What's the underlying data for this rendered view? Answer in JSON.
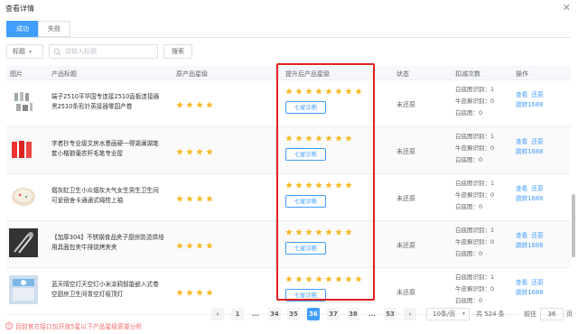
{
  "dialog": {
    "title": "查看详情"
  },
  "tabs": [
    {
      "label": "成功"
    },
    {
      "label": "失败"
    }
  ],
  "search": {
    "select_value": "标题",
    "placeholder": "请输入标题",
    "button": "搜索"
  },
  "table": {
    "headers": [
      "图片",
      "产品标题",
      "原产品星级",
      "提升后产品星级",
      "状态",
      "扣减次数",
      "操作"
    ],
    "rows": [
      {
        "title": "端子2510平华国专连接2510直板连接器黑2510条形针英接器零国产卷",
        "old_stars": 4,
        "new_stars": 8,
        "diag": "七星诊断",
        "status": "未还原",
        "counts": [
          "白底图识别：1",
          "牛皮癣识别：0",
          "白底图：0"
        ],
        "ops": [
          "查看",
          "还原",
          "跳转1688"
        ]
      },
      {
        "title": "字者抄专业级文房水墨画硬一得湖澜湖笔套小楷狼毫农杆毛笔专业屋",
        "old_stars": 4,
        "new_stars": 7,
        "diag": "七星诊断",
        "status": "未还原",
        "counts": [
          "白底图识别：1",
          "牛皮癣识别：0",
          "白底图：0"
        ],
        "ops": [
          "查看",
          "还原",
          "跳转1688"
        ]
      },
      {
        "title": "烟灰缸卫生小众烟灰大气女生男生卫生间可爱宿舍卡通通式绳桂上袖",
        "old_stars": 4,
        "new_stars": 7,
        "diag": "七星诊断",
        "status": "未还原",
        "counts": [
          "白底图识别：1",
          "牛皮癣识别：0",
          "白底图：0"
        ],
        "ops": [
          "查看",
          "还原",
          "跳转1688"
        ]
      },
      {
        "title": "【加厚304】不锈钢食品夹子厨房防烫烘培用具面包夹牛排烧烤夹夹",
        "old_stars": 4,
        "new_stars": 7,
        "diag": "七星诊断",
        "status": "未还原",
        "counts": [
          "白底图识别：1",
          "牛皮癣识别：0",
          "白底图：0"
        ],
        "ops": [
          "查看",
          "还原",
          "跳转1688"
        ]
      },
      {
        "title": "蓝天晴空灯天空灯小米涂鸦智能嵌入式卷空厨房卫生间青空灯吸顶灯",
        "old_stars": 4,
        "new_stars": 8,
        "diag": "七星诊断",
        "status": "未还原",
        "counts": [
          "白底图识别：1",
          "牛皮癣识别：0",
          "白底图：0"
        ],
        "ops": [
          "查看",
          "还原",
          "跳转1688"
        ]
      }
    ]
  },
  "footnote": "目前官方接口仅开放5星以下产品星级质量分析",
  "pagination": {
    "prev": "‹",
    "next": "›",
    "pages": [
      "1",
      "...",
      "34",
      "35",
      "36",
      "37",
      "38",
      "...",
      "53"
    ],
    "current": "36",
    "size": "10条/页",
    "total": "共 524 条",
    "goto_label": "前往",
    "goto_value": "36",
    "page_word": "页"
  },
  "colors": {
    "primary": "#409eff",
    "star": "#f7ba2a",
    "highlight": "#e02020",
    "warn": "#f56c6c"
  }
}
